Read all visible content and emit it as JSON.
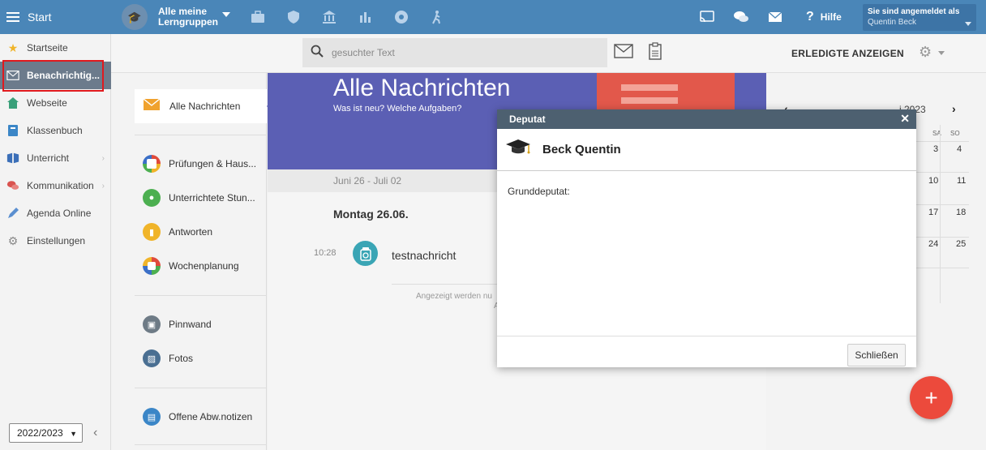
{
  "topbar": {
    "start_label": "Start",
    "group_label_1": "Alle meine",
    "group_label_2": "Lerngruppen",
    "help_label": "Hilfe",
    "user_status": "Sie sind angemeldet als",
    "user_name": "Quentin Beck",
    "icons": [
      "briefcase-icon",
      "shield-icon",
      "bank-icon",
      "bar-chart-icon",
      "badge-icon",
      "hiking-icon",
      "cast-icon",
      "chat-icon",
      "mail-icon",
      "help-icon"
    ]
  },
  "leftnav": {
    "items": [
      {
        "label": "Startseite",
        "icon": "star-icon"
      },
      {
        "label": "Benachrichtig...",
        "icon": "envelope-icon",
        "active": true
      },
      {
        "label": "Webseite",
        "icon": "home-icon"
      },
      {
        "label": "Klassenbuch",
        "icon": "book-icon"
      },
      {
        "label": "Unterricht",
        "icon": "books-icon",
        "has_children": true
      },
      {
        "label": "Kommunikation",
        "icon": "chat-icon",
        "has_children": true
      },
      {
        "label": "Agenda Online",
        "icon": "pen-icon"
      },
      {
        "label": "Einstellungen",
        "icon": "gear-icon"
      }
    ],
    "year": "2022/2023"
  },
  "toolbar": {
    "search_placeholder": "gesuchter Text",
    "show_done_label": "ERLEDIGTE ANZEIGEN"
  },
  "subnav": {
    "active_label": "Alle Nachrichten",
    "items": [
      {
        "label": "Prüfungen & Haus...",
        "color": "#3b6fc7"
      },
      {
        "label": "Unterrichtete Stun...",
        "color": "#4caf50"
      },
      {
        "label": "Antworten",
        "color": "#f0b429"
      },
      {
        "label": "Wochenplanung",
        "color": "#e04b3c"
      },
      {
        "label": "Pinnwand",
        "color": "#6e7b86"
      },
      {
        "label": "Fotos",
        "color": "#4a6f92"
      },
      {
        "label": "Offene Abw.notizen",
        "color": "#3b86c7"
      }
    ]
  },
  "main": {
    "title": "Alle Nachrichten",
    "subtitle": "Was ist neu? Welche Aufgaben?",
    "date_range": "Juni 26 - Juli 02",
    "day_heading": "Montag 26.06.",
    "message_time": "10:28",
    "message_text": "testnachricht",
    "note_line1": "Angezeigt werden nu",
    "note_line2": "A"
  },
  "calendar": {
    "dow": [
      "SA",
      "SO"
    ],
    "rows": [
      [
        "3",
        "4"
      ],
      [
        "10",
        "11"
      ],
      [
        "17",
        "18"
      ],
      [
        "24",
        "25"
      ]
    ],
    "month_partial": "i 2023"
  },
  "modal": {
    "header": "Deputat",
    "name": "Beck Quentin",
    "body_label": "Grunddeputat:",
    "close_button": "Schließen"
  },
  "colors": {
    "topbar": "#4a86b8",
    "banner": "#5b5fb4",
    "fab": "#ec4a3c",
    "active_nav": "#6c7b8c",
    "highlight": "#e0191e"
  }
}
